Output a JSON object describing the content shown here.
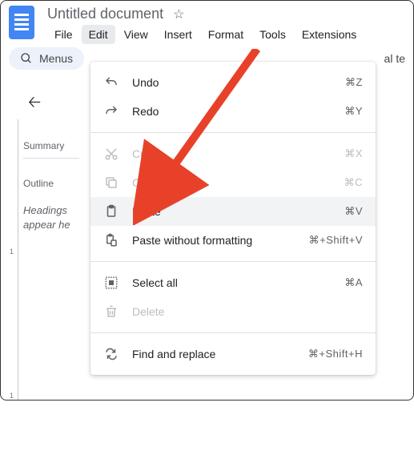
{
  "header": {
    "doc_title": "Untitled document"
  },
  "menubar": {
    "file": "File",
    "edit": "Edit",
    "view": "View",
    "insert": "Insert",
    "format": "Format",
    "tools": "Tools",
    "extensions": "Extensions"
  },
  "toolbar": {
    "search_label": "Menus",
    "right_text": "al te"
  },
  "sidebar": {
    "summary_label": "Summary",
    "outline_label": "Outline",
    "headings_text": "Headings",
    "appear_text": "appear he"
  },
  "ruler": {
    "mark1": "1",
    "mark2": "1"
  },
  "edit_menu": {
    "undo": {
      "label": "Undo",
      "shortcut": "⌘Z"
    },
    "redo": {
      "label": "Redo",
      "shortcut": "⌘Y"
    },
    "cut": {
      "label": "Cut",
      "shortcut": "⌘X"
    },
    "copy": {
      "label": "Copy",
      "shortcut": "⌘C"
    },
    "paste": {
      "label": "Paste",
      "shortcut": "⌘V"
    },
    "paste_no_fmt": {
      "label": "Paste without formatting",
      "shortcut": "⌘+Shift+V"
    },
    "select_all": {
      "label": "Select all",
      "shortcut": "⌘A"
    },
    "delete": {
      "label": "Delete",
      "shortcut": ""
    },
    "find_replace": {
      "label": "Find and replace",
      "shortcut": "⌘+Shift+H"
    }
  }
}
